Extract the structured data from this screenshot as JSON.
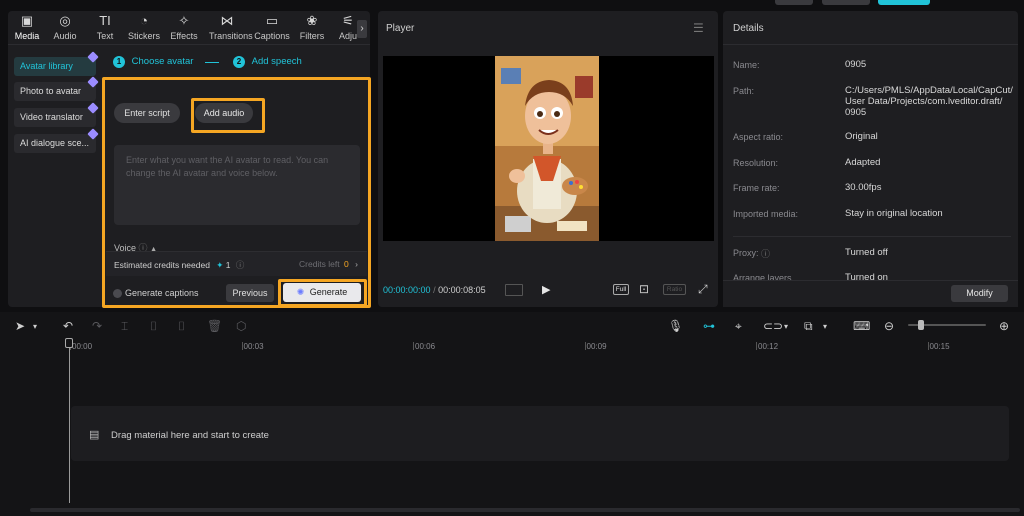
{
  "toolbar": {
    "tabs": [
      {
        "label": "Media",
        "icon": "media-icon",
        "glyph": "▣"
      },
      {
        "label": "Audio",
        "icon": "audio-icon",
        "glyph": "◎"
      },
      {
        "label": "Text",
        "icon": "text-icon",
        "glyph": "TI"
      },
      {
        "label": "Stickers",
        "icon": "stickers-icon",
        "glyph": "◔"
      },
      {
        "label": "Effects",
        "icon": "effects-icon",
        "glyph": "✧"
      },
      {
        "label": "Transitions",
        "icon": "transitions-icon",
        "glyph": "⋈"
      },
      {
        "label": "Captions",
        "icon": "captions-icon",
        "glyph": "▭"
      },
      {
        "label": "Filters",
        "icon": "filters-icon",
        "glyph": "❀"
      },
      {
        "label": "Adju",
        "icon": "adjust-icon",
        "glyph": "⚟"
      }
    ],
    "more_arrow": "›"
  },
  "sidebar": {
    "items": [
      {
        "label": "Avatar library",
        "active": true
      },
      {
        "label": "Photo to avatar",
        "active": false
      },
      {
        "label": "Video translator",
        "active": false
      },
      {
        "label": "AI dialogue sce...",
        "active": false
      }
    ]
  },
  "avatar_panel": {
    "step1_num": "1",
    "step1_label": "Choose avatar",
    "step2_num": "2",
    "step2_label": "Add speech",
    "enter_script": "Enter script",
    "add_audio": "Add audio",
    "placeholder": "Enter what you want the AI avatar to read. You can change the AI avatar and voice below.",
    "voice_label": "Voice",
    "credits_needed_label": "Estimated credits needed",
    "credits_needed_value": "1",
    "credits_left_label": "Credits left",
    "credits_left_value": "0",
    "generate_captions": "Generate captions",
    "previous": "Previous",
    "generate": "Generate"
  },
  "player": {
    "title": "Player",
    "current_time": "00:00:00:00",
    "total_time": "00:00:08:05",
    "full_label": "Full",
    "ratio_label": "Ratio"
  },
  "details": {
    "title": "Details",
    "rows": [
      {
        "label": "Name:",
        "value": "0905"
      },
      {
        "label": "Path:",
        "value": "C:/Users/PMLS/AppData/Local/CapCut/\nUser Data/Projects/com.lveditor.draft/\n0905"
      },
      {
        "label": "Aspect ratio:",
        "value": "Original"
      },
      {
        "label": "Resolution:",
        "value": "Adapted"
      },
      {
        "label": "Frame rate:",
        "value": "30.00fps"
      },
      {
        "label": "Imported media:",
        "value": "Stay in original location"
      },
      {
        "label": "Proxy:",
        "value": "Turned off"
      },
      {
        "label": "Arrange layers",
        "value": "Turned on"
      }
    ],
    "modify": "Modify"
  },
  "timeline": {
    "ruler": [
      "00:00",
      "00:03",
      "00:06",
      "00:09",
      "00:12",
      "00:15"
    ],
    "drop_hint": "Drag material here and start to create"
  },
  "colors": {
    "accent": "#21c3d8",
    "highlight": "#f5a623",
    "panel": "#1e1e21",
    "background": "#0f0f11"
  }
}
